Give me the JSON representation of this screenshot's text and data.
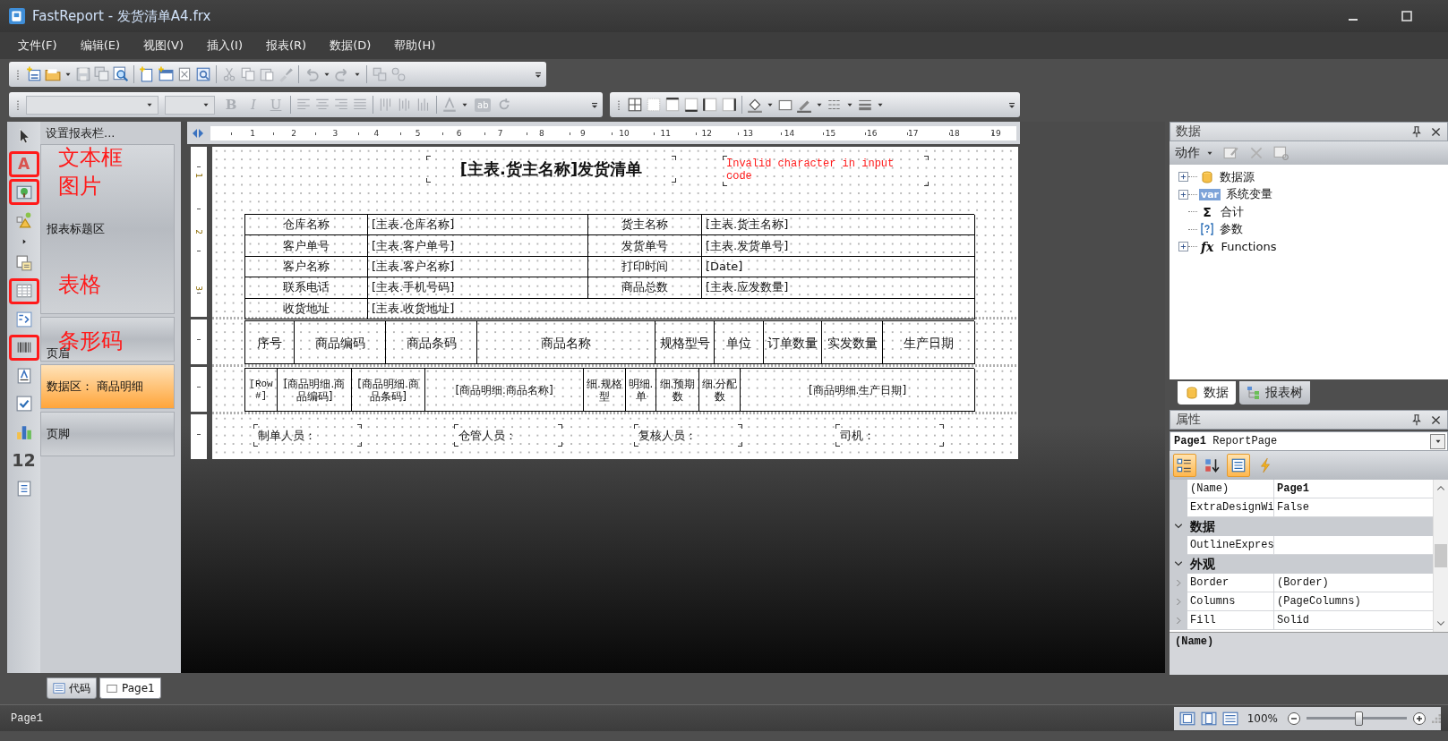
{
  "window": {
    "title": "FastReport - 发货清单A4.frx"
  },
  "menu": [
    "文件(F)",
    "编辑(E)",
    "视图(V)",
    "插入(I)",
    "报表(R)",
    "数据(D)",
    "帮助(H)"
  ],
  "format_toolbar": {
    "style_buttons": [
      {
        "label": "B",
        "disabled": true
      },
      {
        "label": "I",
        "disabled": true
      },
      {
        "label": "U",
        "disabled": true
      }
    ],
    "text_icon": "ab"
  },
  "tools": [
    {
      "kind": "pointer"
    },
    {
      "kind": "glyph",
      "glyph": "A",
      "annotation": "文本框"
    },
    {
      "kind": "picture",
      "annotation": "图片"
    },
    {
      "kind": "shapes"
    },
    {
      "kind": "more"
    },
    {
      "kind": "subreport"
    },
    {
      "kind": "table",
      "annotation": "表格"
    },
    {
      "kind": "matrix"
    },
    {
      "kind": "barcode",
      "annotation": "条形码"
    },
    {
      "kind": "richtext"
    },
    {
      "kind": "checkbox"
    },
    {
      "kind": "chart"
    },
    {
      "kind": "glyph",
      "glyph": "12"
    },
    {
      "kind": "label"
    }
  ],
  "band_panel": {
    "header": "设置报表栏...",
    "bands": [
      {
        "kind": "title",
        "label": "报表标题区",
        "selected": false
      },
      {
        "kind": "header",
        "label": "页眉",
        "selected": false
      },
      {
        "kind": "data",
        "label": "数据区： 商品明细",
        "selected": true
      },
      {
        "kind": "footer",
        "label": "页脚",
        "selected": false
      }
    ]
  },
  "report": {
    "top_ruler": [
      "1",
      "2",
      "3",
      "4",
      "5",
      "6",
      "7",
      "8",
      "9",
      "10",
      "11",
      "12",
      "13",
      "14",
      "15",
      "16",
      "17",
      "18",
      "19"
    ],
    "left_ruler": [
      "1",
      "2",
      "3"
    ],
    "title": "[主表.货主名称]发货清单",
    "error": "Invalid character in input code",
    "info_rows": [
      {
        "cells": [
          "仓库名称",
          "[主表.仓库名称]",
          "货主名称",
          "[主表.货主名称]"
        ]
      },
      {
        "cells": [
          "客户单号",
          "[主表.客户单号]",
          "发货单号",
          "[主表.发货单号]"
        ]
      },
      {
        "cells": [
          "客户名称",
          "[主表.客户名称]",
          "打印时间",
          "[Date]"
        ]
      },
      {
        "cells": [
          "联系电话",
          "[主表.手机号码]",
          "商品总数",
          "[主表.应发数量]"
        ]
      },
      {
        "cells": [
          "收货地址",
          "[主表.收货地址]"
        ]
      }
    ],
    "header_columns": [
      "序号",
      "商品编码",
      "商品条码",
      "商品名称",
      "规格型号",
      "单位",
      "订单数量",
      "实发数量",
      "生产日期"
    ],
    "data_cells": [
      "[Row#]",
      "[商品明细.商品编码]",
      "[商品明细.商品条码]",
      "[商品明细.商品名称]",
      "细.规格型",
      "明细.单",
      "细.预期数",
      "细.分配数",
      "[商品明细.生产日期]"
    ],
    "footer_fields": [
      "制单人员：",
      "仓管人员：",
      "复核人员：",
      "司机："
    ]
  },
  "page_tabs": [
    {
      "label": "代码",
      "selected": false
    },
    {
      "label": "Page1",
      "selected": true
    }
  ],
  "data_panel": {
    "title": "数据",
    "action_label": "动作",
    "tree": [
      {
        "label": "数据源",
        "kind": "database",
        "expanded": false
      },
      {
        "label": "系统变量",
        "kind": "var",
        "icon_text": "var",
        "expanded": false
      },
      {
        "label": "合计",
        "kind": "sigma",
        "icon_text": "Σ"
      },
      {
        "label": "参数",
        "kind": "param"
      },
      {
        "label": "Functions",
        "kind": "fx",
        "icon_text": "fx",
        "expanded": false
      }
    ],
    "tabs": [
      {
        "label": "数据",
        "kind": "database",
        "selected": true
      },
      {
        "label": "报表树",
        "kind": "tree",
        "selected": false
      }
    ]
  },
  "properties_panel": {
    "title": "属性",
    "selector": "**Page1** ReportPage",
    "toolbar": [
      {
        "kind": "categorized",
        "selected": true
      },
      {
        "kind": "alphabetical",
        "selected": false
      },
      {
        "kind": "properties",
        "selected": true
      },
      {
        "kind": "events",
        "selected": false
      }
    ],
    "rows": [
      {
        "kind": "property",
        "name": "(Name)",
        "value": "Page1",
        "bold": true
      },
      {
        "kind": "property",
        "name": "ExtraDesignWi",
        "value": "False"
      },
      {
        "kind": "category",
        "name": "数据",
        "expanded": true
      },
      {
        "kind": "property",
        "name": "OutlineExpres"
      },
      {
        "kind": "category",
        "name": "外观",
        "expanded": true
      },
      {
        "kind": "property",
        "name": "Border",
        "value": "(Border)",
        "expandable": true
      },
      {
        "kind": "property",
        "name": "Columns",
        "value": "(PageColumns)",
        "expandable": true
      },
      {
        "kind": "property",
        "name": "Fill",
        "value": "Solid",
        "expandable": true
      }
    ],
    "description": "(Name)"
  },
  "status_bar": {
    "text": "Page1",
    "zoom": {
      "reading": "100%",
      "level": 0.52
    }
  }
}
